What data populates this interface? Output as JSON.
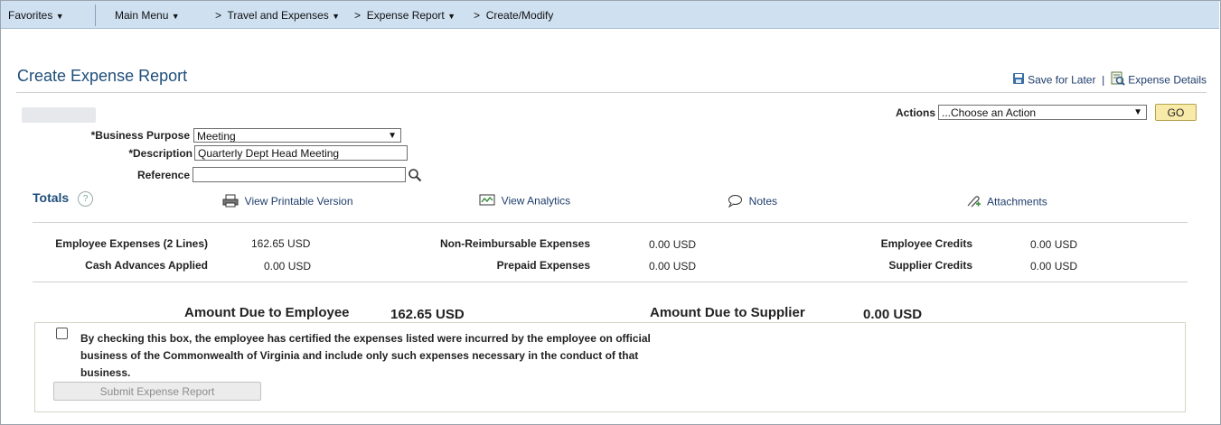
{
  "nav": {
    "favorites": "Favorites",
    "main_menu": "Main Menu",
    "breadcrumb": [
      "Travel and Expenses",
      "Expense Report",
      "Create/Modify"
    ]
  },
  "page": {
    "title": "Create Expense Report",
    "save_for_later": "Save for Later",
    "link_separator": "|",
    "expense_details": "Expense Details"
  },
  "actions": {
    "label": "Actions",
    "selected": "...Choose an Action",
    "go": "GO"
  },
  "form": {
    "business_purpose_label": "*Business Purpose",
    "business_purpose_value": "Meeting",
    "description_label": "*Description",
    "description_value": "Quarterly Dept Head Meeting",
    "reference_label": "Reference",
    "reference_value": ""
  },
  "toolbar": {
    "totals": "Totals",
    "help": "?",
    "printable": "View Printable Version",
    "analytics": "View Analytics",
    "notes": "Notes",
    "attachments": "Attachments"
  },
  "totals": {
    "employee_expenses_label": "Employee Expenses (2 Lines)",
    "employee_expenses_value": "162.65  USD",
    "cash_advances_label": "Cash Advances Applied",
    "cash_advances_value": "0.00  USD",
    "non_reimbursable_label": "Non-Reimbursable Expenses",
    "non_reimbursable_value": "0.00  USD",
    "prepaid_label": "Prepaid Expenses",
    "prepaid_value": "0.00  USD",
    "employee_credits_label": "Employee Credits",
    "employee_credits_value": "0.00  USD",
    "supplier_credits_label": "Supplier Credits",
    "supplier_credits_value": "0.00  USD"
  },
  "due": {
    "employee_label": "Amount Due to Employee",
    "employee_value": "162.65  USD",
    "supplier_label": "Amount Due to Supplier",
    "supplier_value": "0.00  USD"
  },
  "certification": {
    "checked": false,
    "text": "By checking this box, the employee has certified the expenses listed were incurred by the employee on official business of the Commonwealth of Virginia and include only such expenses necessary in the conduct of that business.",
    "submit": "Submit Expense Report"
  },
  "colors": {
    "nav_bg": "#cfe0f1",
    "title": "#1f4e79",
    "go_button": "#f8eaa8"
  },
  "icons": [
    "chevron-down-icon",
    "chevron-right-icon",
    "save-icon",
    "expense-details-icon",
    "search-icon",
    "help-icon",
    "printer-icon",
    "analytics-icon",
    "notes-icon",
    "attachment-icon"
  ]
}
